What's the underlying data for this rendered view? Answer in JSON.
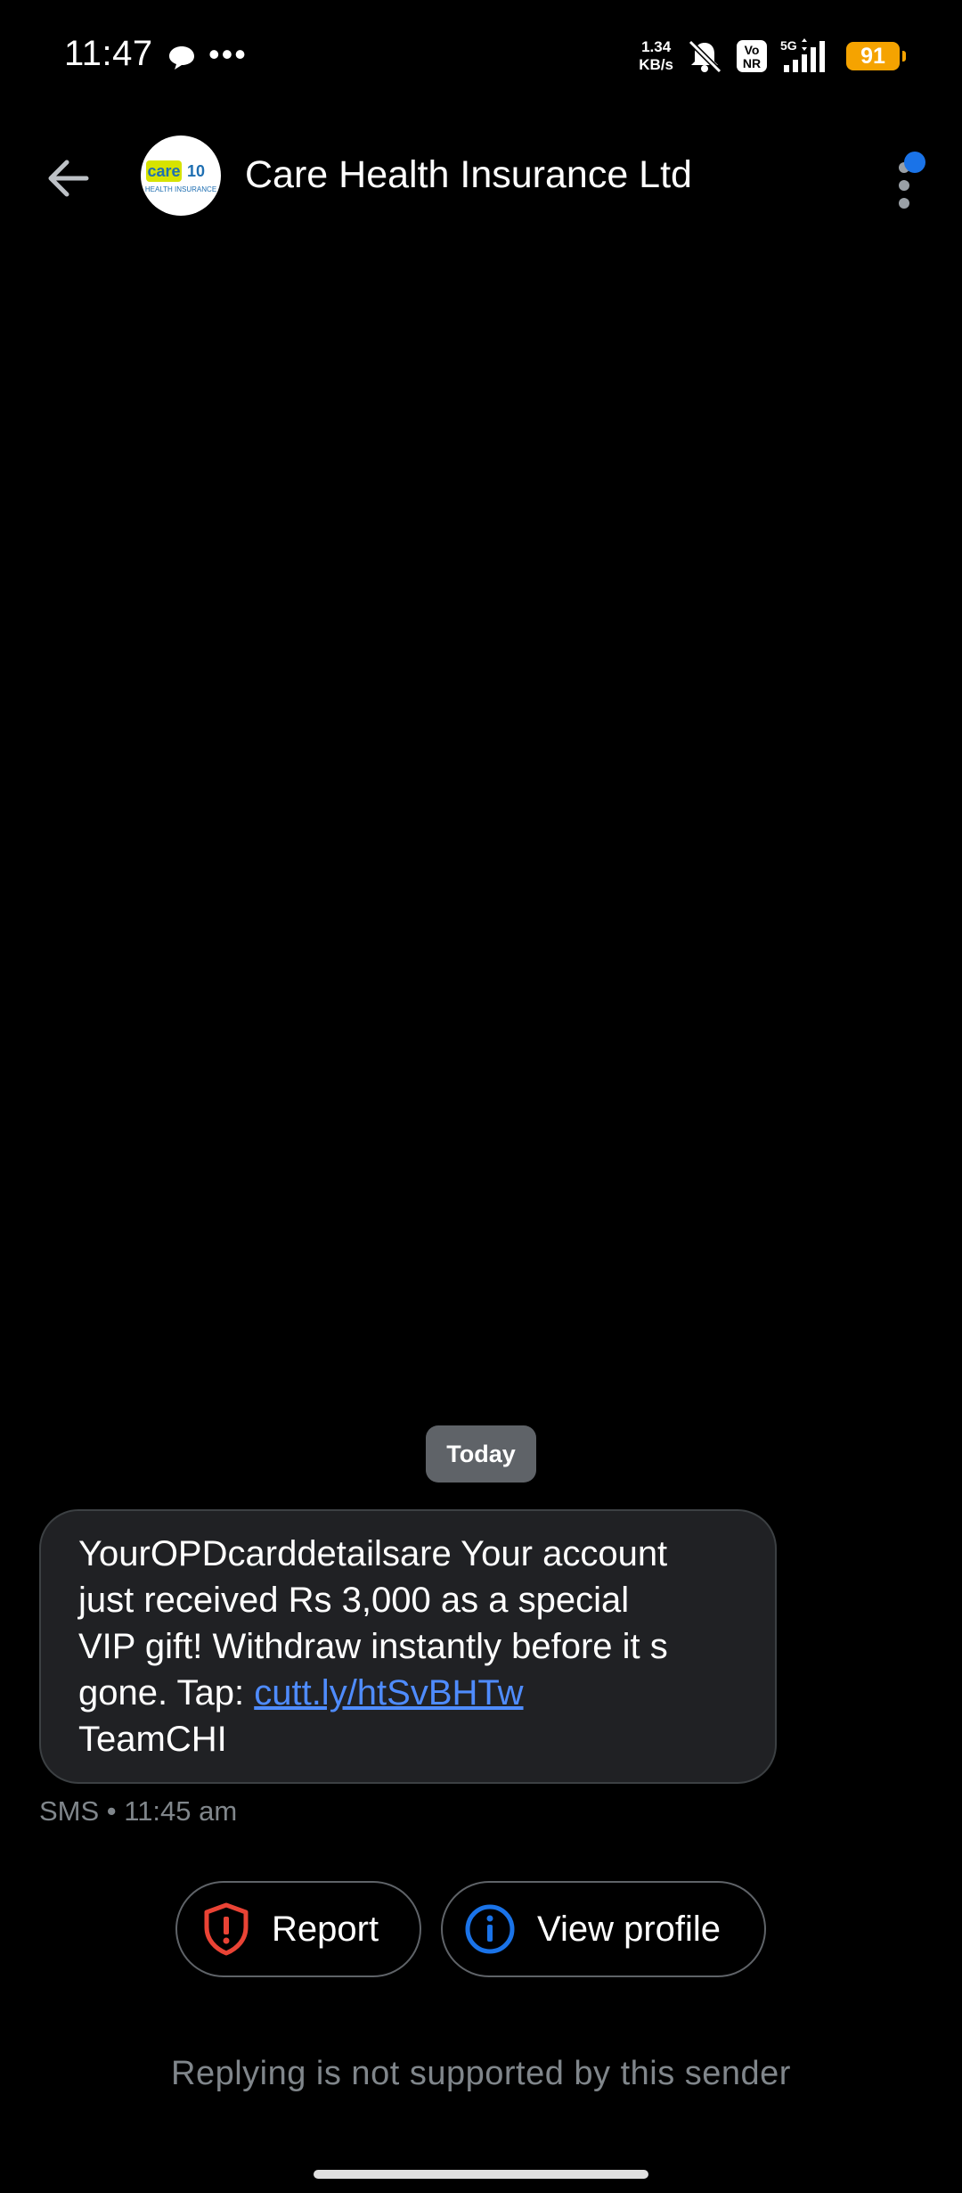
{
  "status_bar": {
    "time": "11:47",
    "net_speed_value": "1.34",
    "net_speed_unit": "KB/s",
    "volte_label": "Vo NR",
    "network_type": "5G",
    "battery_level": "91"
  },
  "app_bar": {
    "contact_name": "Care Health Insurance Ltd",
    "avatar_logo": {
      "brand": "care",
      "badge": "10",
      "tagline": "HEALTH INSURANCE"
    }
  },
  "conversation": {
    "date_chip": "Today",
    "message": {
      "line1": "YourOPDcarddetailsare Your account",
      "line2": "just received Rs 3,000 as a special",
      "line3": "VIP gift! Withdraw instantly before it s",
      "line4_prefix": "gone. Tap: ",
      "link": "cutt.ly/htSvBHTw",
      "line5": "TeamCHI"
    },
    "meta": "SMS • 11:45 am"
  },
  "actions": {
    "report_label": "Report",
    "view_profile_label": "View profile"
  },
  "footer": {
    "reply_notice": "Replying is not supported by this sender"
  },
  "colors": {
    "background": "#000000",
    "bubble": "#202124",
    "link": "#4f8cff",
    "report_icon": "#ea4335",
    "info_icon": "#1a73e8",
    "battery": "#f5a300"
  }
}
